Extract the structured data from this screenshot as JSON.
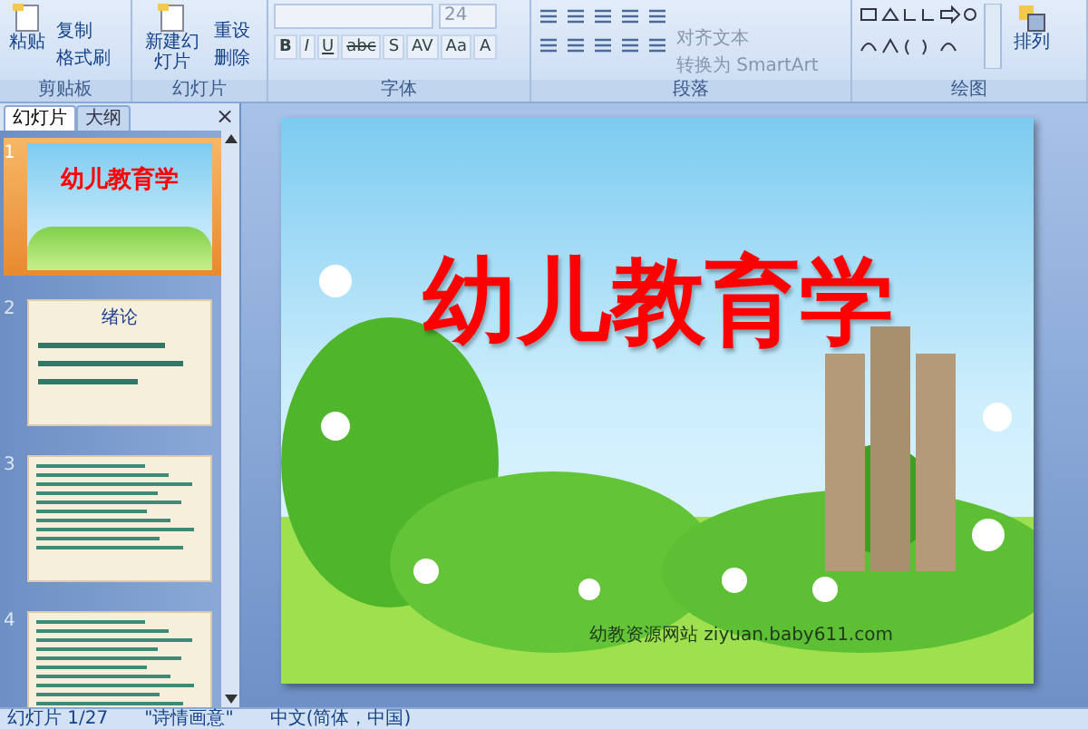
{
  "ribbon": {
    "groups": [
      {
        "label": "剪贴板",
        "big": "粘贴",
        "small": [
          "复制",
          "格式刷"
        ]
      },
      {
        "label": "幻灯片",
        "big": "新建幻灯片",
        "small": [
          "重设",
          "删除"
        ]
      },
      {
        "label": "字体",
        "size": "24",
        "buttons": [
          "B",
          "I",
          "U",
          "abc",
          "S",
          "AV",
          "Aa",
          "A"
        ]
      },
      {
        "label": "段落",
        "small": [
          "对齐文本",
          "转换为 SmartArt"
        ]
      },
      {
        "label": "绘图",
        "big": "排列"
      }
    ]
  },
  "pane": {
    "tabs": [
      {
        "label": "幻灯片",
        "selected": true
      },
      {
        "label": "大纲",
        "selected": false
      }
    ],
    "close": "×",
    "slides": [
      {
        "number": "1",
        "selected": true,
        "kind": "title",
        "title": "幼儿教育学"
      },
      {
        "number": "2",
        "selected": false,
        "kind": "list",
        "title": "绪论"
      },
      {
        "number": "3",
        "selected": false,
        "kind": "text"
      },
      {
        "number": "4",
        "selected": false,
        "kind": "text"
      }
    ]
  },
  "slide": {
    "title": "幼儿教育学",
    "site": "幼教资源网站 ziyuan.baby611.com"
  },
  "status_bar": [
    "幻灯片 1/27",
    "\"诗情画意\"",
    "中文(简体，中国)"
  ]
}
